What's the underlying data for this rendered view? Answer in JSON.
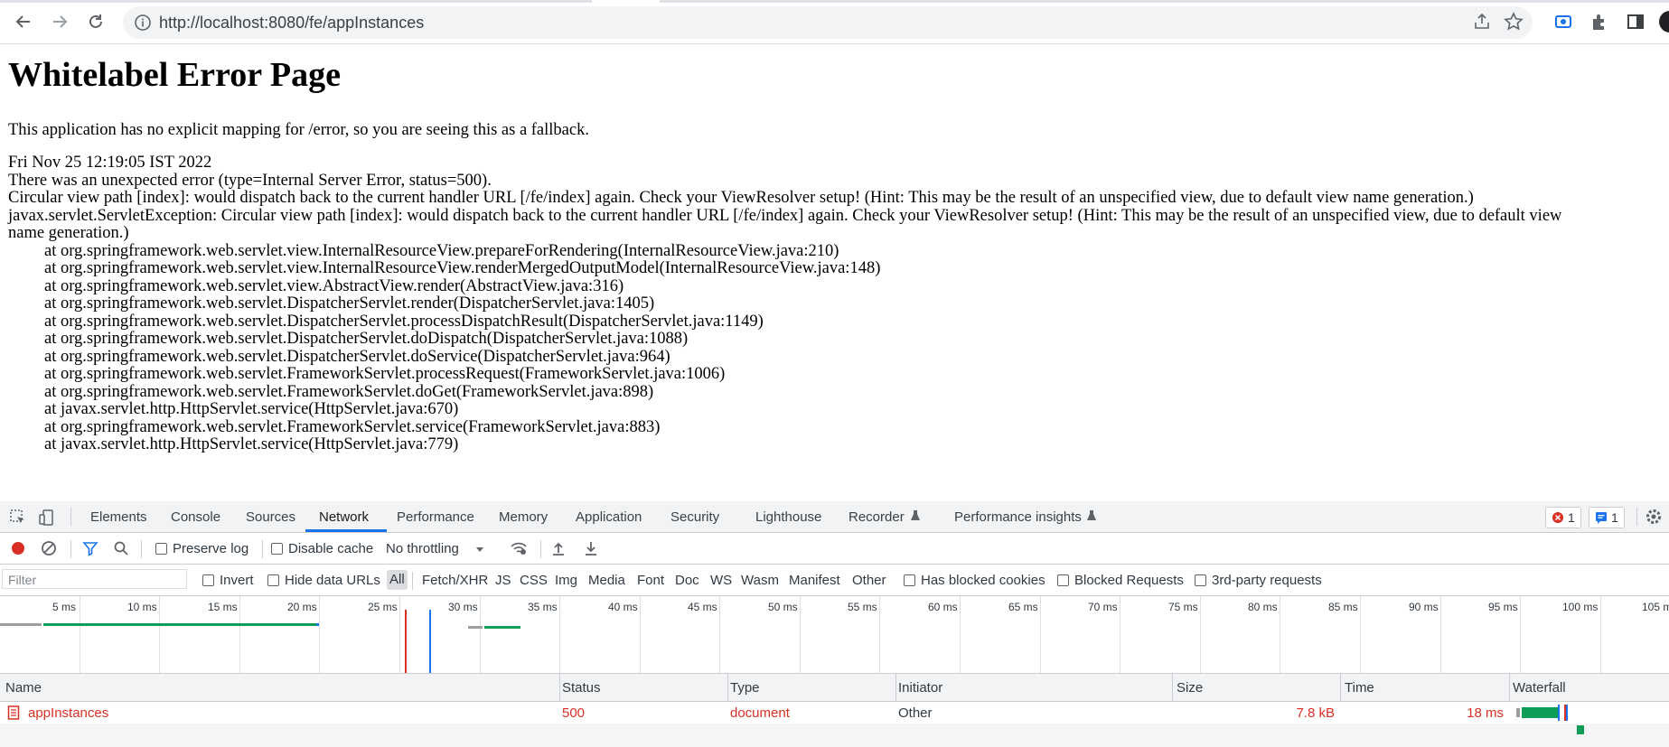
{
  "browser": {
    "url": "http://localhost:8080/fe/appInstances",
    "icons": [
      "back-icon",
      "forward-icon",
      "reload-icon",
      "site-info-icon",
      "share-icon",
      "bookmark-star-icon",
      "screencast-icon",
      "extensions-icon",
      "side-panel-icon",
      "profile-avatar"
    ]
  },
  "page": {
    "title": "Whitelabel Error Page",
    "intro": "This application has no explicit mapping for /error, so you are seeing this as a fallback.",
    "timestamp": "Fri Nov 25 12:19:05 IST 2022",
    "error_line": "There was an unexpected error (type=Internal Server Error, status=500).",
    "message": "Circular view path [index]: would dispatch back to the current handler URL [/fe/index] again. Check your ViewResolver setup! (Hint: This may be the result of an unspecified view, due to default view name generation.)",
    "exception_line1": "javax.servlet.ServletException: Circular view path [index]: would dispatch back to the current handler URL [/fe/index] again. Check your ViewResolver setup! (Hint: This may be the result of an unspecified view, due to default view",
    "exception_line2": "name generation.)",
    "stack": [
      "at org.springframework.web.servlet.view.InternalResourceView.prepareForRendering(InternalResourceView.java:210)",
      "at org.springframework.web.servlet.view.InternalResourceView.renderMergedOutputModel(InternalResourceView.java:148)",
      "at org.springframework.web.servlet.view.AbstractView.render(AbstractView.java:316)",
      "at org.springframework.web.servlet.DispatcherServlet.render(DispatcherServlet.java:1405)",
      "at org.springframework.web.servlet.DispatcherServlet.processDispatchResult(DispatcherServlet.java:1149)",
      "at org.springframework.web.servlet.DispatcherServlet.doDispatch(DispatcherServlet.java:1088)",
      "at org.springframework.web.servlet.DispatcherServlet.doService(DispatcherServlet.java:964)",
      "at org.springframework.web.servlet.FrameworkServlet.processRequest(FrameworkServlet.java:1006)",
      "at org.springframework.web.servlet.FrameworkServlet.doGet(FrameworkServlet.java:898)",
      "at javax.servlet.http.HttpServlet.service(HttpServlet.java:670)",
      "at org.springframework.web.servlet.FrameworkServlet.service(FrameworkServlet.java:883)",
      "at javax.servlet.http.HttpServlet.service(HttpServlet.java:779)"
    ]
  },
  "devtools": {
    "tabs": [
      "Elements",
      "Console",
      "Sources",
      "Network",
      "Performance",
      "Memory",
      "Application",
      "Security",
      "Lighthouse",
      "Recorder",
      "Performance insights"
    ],
    "active_tab": "Network",
    "error_count": "1",
    "message_count": "1",
    "toolbar": {
      "preserve_log": "Preserve log",
      "disable_cache": "Disable cache",
      "throttling": "No throttling"
    },
    "filter": {
      "placeholder": "Filter",
      "invert": "Invert",
      "hide_data_urls": "Hide data URLs",
      "types": [
        "All",
        "Fetch/XHR",
        "JS",
        "CSS",
        "Img",
        "Media",
        "Font",
        "Doc",
        "WS",
        "Wasm",
        "Manifest",
        "Other"
      ],
      "has_blocked_cookies": "Has blocked cookies",
      "blocked_requests": "Blocked Requests",
      "third_party": "3rd-party requests"
    },
    "overview_ticks": [
      "5 ms",
      "10 ms",
      "15 ms",
      "20 ms",
      "25 ms",
      "30 ms",
      "35 ms",
      "40 ms",
      "45 ms",
      "50 ms",
      "55 ms",
      "60 ms",
      "65 ms",
      "70 ms",
      "75 ms",
      "80 ms",
      "85 ms",
      "90 ms",
      "95 ms",
      "100 ms",
      "105 m"
    ],
    "columns": [
      "Name",
      "Status",
      "Type",
      "Initiator",
      "Size",
      "Time",
      "Waterfall"
    ],
    "rows": [
      {
        "name": "appInstances",
        "status": "500",
        "type": "document",
        "initiator": "Other",
        "size": "7.8 kB",
        "time": "18 ms"
      }
    ]
  },
  "colors": {
    "error_red": "#d93025",
    "accent_blue": "#1a73e8",
    "record_red": "#d93025"
  }
}
